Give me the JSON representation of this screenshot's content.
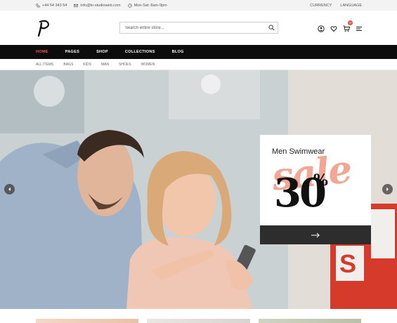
{
  "topbar": {
    "phone": "+44 54 343 54",
    "email": "info@lo-studioweb.com",
    "hours": "Mon-Sat: 8am-9pm",
    "currency_label": "CURRENCY",
    "language_label": "LANGUAGE"
  },
  "header": {
    "search_placeholder": "Search entire store...",
    "cart_count": "0"
  },
  "main_nav": {
    "items": [
      "HOME",
      "PAGES",
      "SHOP",
      "COLLECTIONS",
      "BLOG"
    ],
    "active": "HOME"
  },
  "sub_nav": {
    "items": [
      "ALL ITEMS",
      "BAGS",
      "KIDS",
      "MAN",
      "SHOES",
      "WOMEN"
    ]
  },
  "hero": {
    "promo_title": "Men Swimwear",
    "promo_sale": "sale",
    "promo_discount": "30",
    "promo_percent": "%"
  },
  "colors": {
    "accent": "#f25b4a",
    "nav_bg": "#0c0c0c",
    "promo_button_bg": "#2d2d2d",
    "sale_script": "#f2a38f"
  },
  "icons": {
    "phone": "phone-icon",
    "email": "envelope-icon",
    "hours": "clock-icon",
    "search": "search-icon",
    "account": "user-icon",
    "wishlist": "heart-icon",
    "cart": "cart-icon",
    "menu": "menu-icon",
    "prev": "chevron-left-icon",
    "next": "chevron-right-icon",
    "promo_arrow": "arrow-right-icon"
  }
}
